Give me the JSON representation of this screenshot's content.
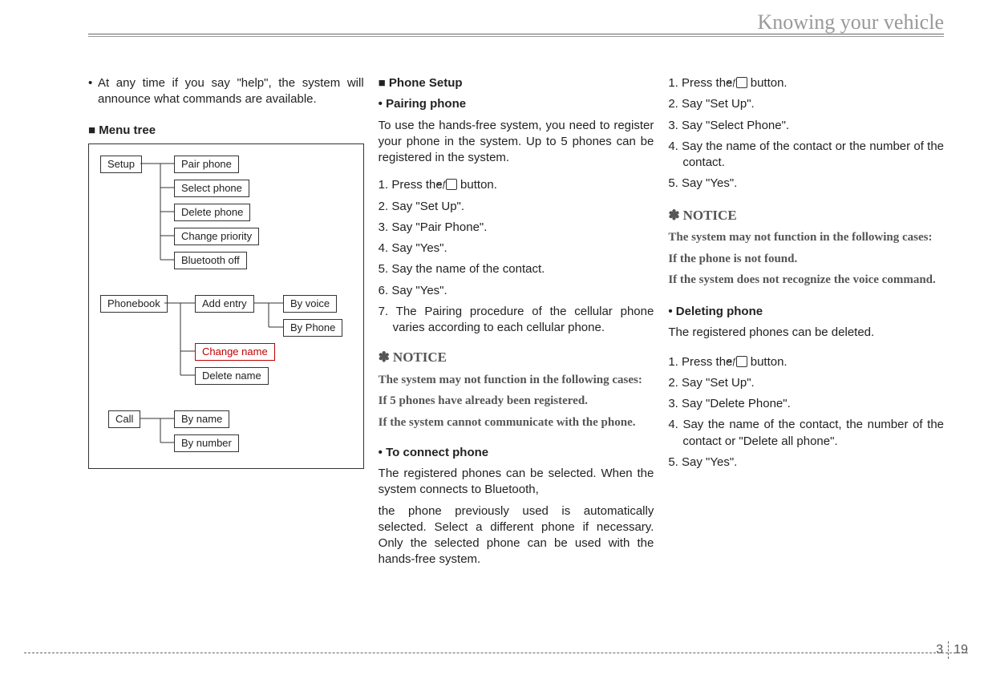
{
  "header": {
    "title": "Knowing your vehicle"
  },
  "col1": {
    "bullet1": "At any time if you say \"help\", the system will announce what commands are available.",
    "menuTreeHeading": "■ Menu tree"
  },
  "tree": {
    "setup": {
      "root": "Setup",
      "items": [
        "Pair phone",
        "Select phone",
        "Delete phone",
        "Change priority",
        "Bluetooth off"
      ]
    },
    "phonebook": {
      "root": "Phonebook",
      "addEntry": "Add entry",
      "byVoice": "By voice",
      "byPhone": "By Phone",
      "changeName": "Change name",
      "deleteName": "Delete name"
    },
    "call": {
      "root": "Call",
      "byName": "By name",
      "byNumber": "By number"
    }
  },
  "col2": {
    "phoneSetupHeading": "■ Phone Setup",
    "pairingPhoneHeading": "• Pairing phone",
    "pairingIntro": "To use the hands-free system, you need to register your phone in the system. Up to 5 phones can be registered in the system.",
    "steps": {
      "s1a": "1. Press the ",
      "s1b": " button.",
      "s2": "2. Say \"Set Up\".",
      "s3": "3. Say \"Pair Phone\".",
      "s4": "4. Say \"Yes\".",
      "s5": "5. Say the name of the contact.",
      "s6": "6. Say \"Yes\".",
      "s7": "7. The Pairing procedure of the cellular phone varies according to each cellular phone."
    },
    "noticeLabel": "NOTICE",
    "noticeStar": "✽",
    "noticeBody1": "The system may not function in the following cases:",
    "noticeBody2": "If 5 phones have already been registered.",
    "noticeBody3": "If the system cannot communicate with the phone.",
    "toConnectHeading": "• To connect phone",
    "toConnectP1": "The registered phones can be selected. When the system connects to Bluetooth,",
    "toConnectP2": "the phone previously used is automatically selected. Select a different phone if necessary. Only the selected phone can be used with the hands-free system."
  },
  "col3": {
    "stepsA": {
      "s1a": "1. Press the ",
      "s1b": " button.",
      "s2": "2. Say \"Set Up\".",
      "s3": "3. Say \"Select Phone\".",
      "s4": "4. Say the name of the contact or the number of the contact.",
      "s5": "5. Say \"Yes\"."
    },
    "noticeLabel": "NOTICE",
    "noticeStar": "✽",
    "noticeBody1": "The system may not function in the following cases:",
    "noticeBody2": "If the phone is not found.",
    "noticeBody3": "If the system does not recognize the voice command.",
    "deletingHeading": "• Deleting phone",
    "deletingIntro": "The registered phones can be deleted.",
    "stepsB": {
      "s1a": "1. Press the ",
      "s1b": " button.",
      "s2": "2. Say \"Set Up\".",
      "s3": "3. Say \"Delete Phone\".",
      "s4": "4. Say the name of the contact, the number of the contact  or \"Delete all phone\".",
      "s5": "5. Say \"Yes\"."
    }
  },
  "footer": {
    "section": "3",
    "page": "19"
  },
  "icons": {
    "talk": "«ƒ"
  }
}
